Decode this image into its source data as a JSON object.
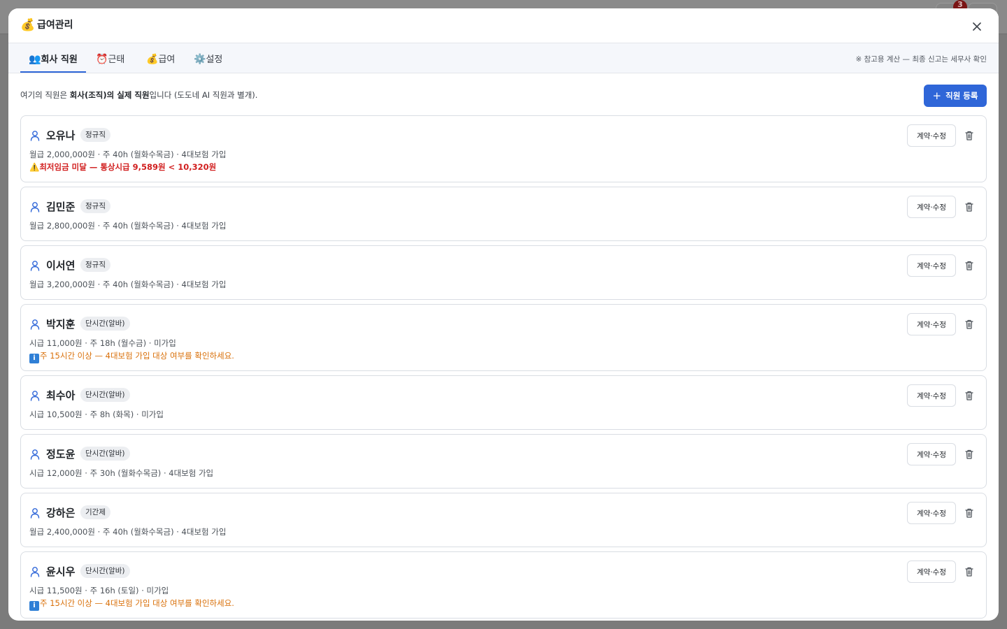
{
  "backdrop": {
    "notification_count": "3"
  },
  "modal": {
    "title_icon": "💰",
    "title": "급여관리",
    "close_icon": "close-icon"
  },
  "tabs": [
    {
      "emoji": "👥",
      "label": "회사 직원",
      "active": true
    },
    {
      "emoji": "⏰",
      "label": "근태",
      "active": false
    },
    {
      "emoji": "💰",
      "label": "급여",
      "active": false
    },
    {
      "emoji": "⚙️",
      "label": "설정",
      "active": false
    }
  ],
  "tab_note": "※ 참고용 계산 — 최종 신고는 세무사 확인",
  "intro": {
    "prefix": "여기의 직원은 ",
    "bold": "회사(조직)의 실제 직원",
    "suffix": "입니다 (도도네 AI 직원과 별개)."
  },
  "add_button": {
    "plus": "+",
    "label": "직원 등록"
  },
  "edit_label": "계약·수정",
  "colors": {
    "accent": "#2f66d8",
    "warn_red": "#d11f1f",
    "warn_orange": "#d9700a"
  },
  "employees": [
    {
      "name": "오유나",
      "type": "정규직",
      "detail": "월급 2,000,000원 · 주 40h (월화수목금) · 4대보험 가입",
      "warn_icon": "⚠️",
      "warning": "최저임금 미달 — 통상시급 9,589원 < 10,320원",
      "warn_level": "red"
    },
    {
      "name": "김민준",
      "type": "정규직",
      "detail": "월급 2,800,000원 · 주 40h (월화수목금) · 4대보험 가입"
    },
    {
      "name": "이서연",
      "type": "정규직",
      "detail": "월급 3,200,000원 · 주 40h (월화수목금) · 4대보험 가입"
    },
    {
      "name": "박지훈",
      "type": "단시간(알바)",
      "detail": "시급 11,000원 · 주 18h (월수금) · 미가입",
      "warn_icon": "i",
      "warning": "주 15시간 이상 — 4대보험 가입 대상 여부를 확인하세요.",
      "warn_level": "orange"
    },
    {
      "name": "최수아",
      "type": "단시간(알바)",
      "detail": "시급 10,500원 · 주 8h (화목) · 미가입"
    },
    {
      "name": "정도윤",
      "type": "단시간(알바)",
      "detail": "시급 12,000원 · 주 30h (월화수목금) · 4대보험 가입"
    },
    {
      "name": "강하은",
      "type": "기간제",
      "detail": "월급 2,400,000원 · 주 40h (월화수목금) · 4대보험 가입"
    },
    {
      "name": "윤시우",
      "type": "단시간(알바)",
      "detail": "시급 11,500원 · 주 16h (토일) · 미가입",
      "warn_icon": "i",
      "warning": "주 15시간 이상 — 4대보험 가입 대상 여부를 확인하세요.",
      "warn_level": "orange"
    }
  ]
}
